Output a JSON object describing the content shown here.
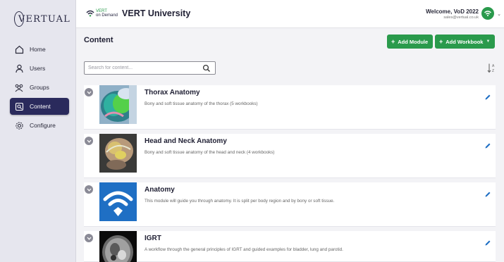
{
  "app": {
    "logo_text": "VERTUAL",
    "brand_small_top": "VERT",
    "brand_small_bottom": "on Demand",
    "brand_title": "VERT University"
  },
  "user": {
    "welcome": "Welcome, VoD 2022",
    "email": "sales@vertual.co.uk"
  },
  "sidebar": {
    "items": [
      {
        "label": "Home",
        "icon": "home-icon",
        "active": false
      },
      {
        "label": "Users",
        "icon": "user-icon",
        "active": false
      },
      {
        "label": "Groups",
        "icon": "groups-icon",
        "active": false
      },
      {
        "label": "Content",
        "icon": "content-icon",
        "active": true
      },
      {
        "label": "Configure",
        "icon": "gear-icon",
        "active": false
      }
    ]
  },
  "main": {
    "title": "Content",
    "add_module_label": "Add Module",
    "add_workbook_label": "Add Workbook",
    "search_placeholder": "Search for content..."
  },
  "content_items": [
    {
      "title": "Thorax Anatomy",
      "description": "Bony and soft tissue anatomy of the thorax (5 workbooks)",
      "thumb": "thorax-thumbnail"
    },
    {
      "title": "Head and Neck Anatomy",
      "description": "Bony and soft tissue anatomy of the head and neck (4 workbooks)",
      "thumb": "head-neck-thumbnail"
    },
    {
      "title": "Anatomy",
      "description": "This module will guide you through anatomy. It is split per body region and by bony or soft tissue.",
      "thumb": "wifi-logo-thumbnail"
    },
    {
      "title": "IGRT",
      "description": "A workflow through the general principles of IGRT and guided examples for bladder, lung and parotid.",
      "thumb": "ct-scan-thumbnail"
    }
  ],
  "colors": {
    "accent_green": "#2a9a4c",
    "nav_active": "#2a2a5c",
    "anatomy_blue": "#1f6fc4"
  }
}
